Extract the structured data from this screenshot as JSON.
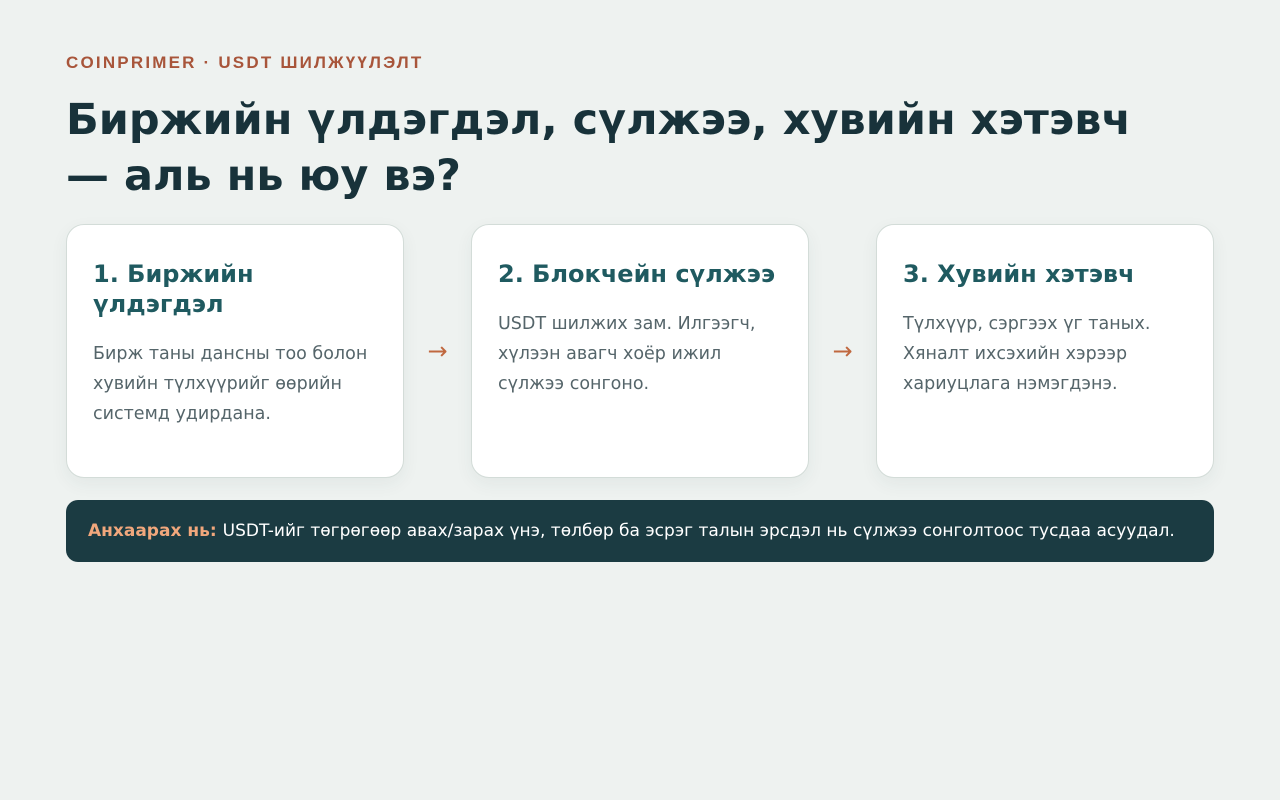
{
  "header": {
    "eyebrow": "COINPRIMER · USDT ШИЛЖҮҮЛЭЛТ",
    "title": "Биржийн үлдэгдэл, сүлжээ, хувийн хэтэвч — аль нь юу вэ?"
  },
  "steps": [
    {
      "title": "1. Биржийн үлдэгдэл",
      "text": "Бирж таны дансны тоо болон хувийн түлхүүрийг өөрийн системд удирдана."
    },
    {
      "title": "2. Блокчейн сүлжээ",
      "text": "USDT шилжих зам. Илгээгч, хүлээн авагч хоёр ижил сүлжээ сонгоно."
    },
    {
      "title": "3. Хувийн хэтэвч",
      "text": "Түлхүүр, сэргээх үг таных. Хяналт ихсэхийн хэрээр хариуцлага нэмэгдэнэ."
    }
  ],
  "arrows": [
    "→",
    "→"
  ],
  "note": {
    "label": "Анхаарах нь:",
    "text": "USDT-ийг төгрөгөөр авах/зарах үнэ, төлбөр ба эсрэг талын эрсдэл нь сүлжээ сонголтоос тусдаа асуудал."
  },
  "colors": {
    "background": "#eef2f0",
    "accent": "#a8553a",
    "card_title": "#1f5a60",
    "note_bg": "#1b3b42",
    "note_label": "#f1a77c"
  }
}
